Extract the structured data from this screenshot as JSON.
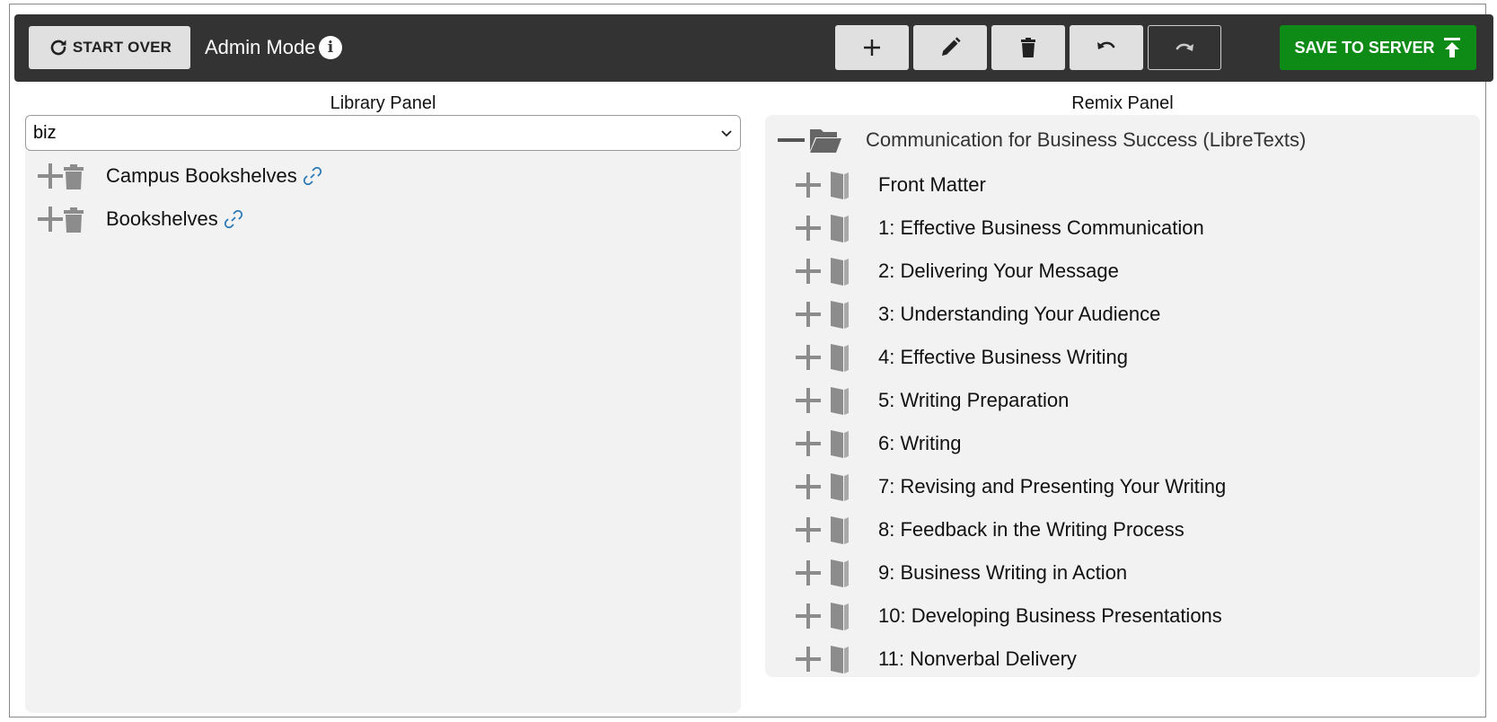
{
  "toolbar": {
    "start_over_label": "START OVER",
    "admin_mode_label": "Admin Mode",
    "save_label": "SAVE TO SERVER"
  },
  "library": {
    "title": "Library Panel",
    "select_value": "biz",
    "items": [
      {
        "label": "Campus Bookshelves"
      },
      {
        "label": "Bookshelves"
      }
    ]
  },
  "remix": {
    "title": "Remix Panel",
    "root": {
      "label": "Communication for Business Success (LibreTexts)"
    },
    "items": [
      {
        "label": "Front Matter"
      },
      {
        "label": "1: Effective Business Communication"
      },
      {
        "label": "2: Delivering Your Message"
      },
      {
        "label": "3: Understanding Your Audience"
      },
      {
        "label": "4: Effective Business Writing"
      },
      {
        "label": "5: Writing Preparation"
      },
      {
        "label": "6: Writing"
      },
      {
        "label": "7: Revising and Presenting Your Writing"
      },
      {
        "label": "8: Feedback in the Writing Process"
      },
      {
        "label": "9: Business Writing in Action"
      },
      {
        "label": "10: Developing Business Presentations"
      },
      {
        "label": "11: Nonverbal Delivery"
      }
    ]
  },
  "colors": {
    "toolbar_bg": "#333333",
    "save_green": "#0e8a16",
    "panel_bg": "#f2f2f2",
    "icon_gray": "#8c8c8c",
    "link_blue": "#2a7ab8"
  },
  "icons": [
    "redo-icon",
    "info-icon",
    "plus-icon",
    "pencil-icon",
    "trash-icon",
    "undo-icon",
    "redo-icon",
    "upload-icon",
    "minus-icon",
    "folder-open-icon",
    "book-icon",
    "link-icon",
    "chevron-down-icon"
  ]
}
